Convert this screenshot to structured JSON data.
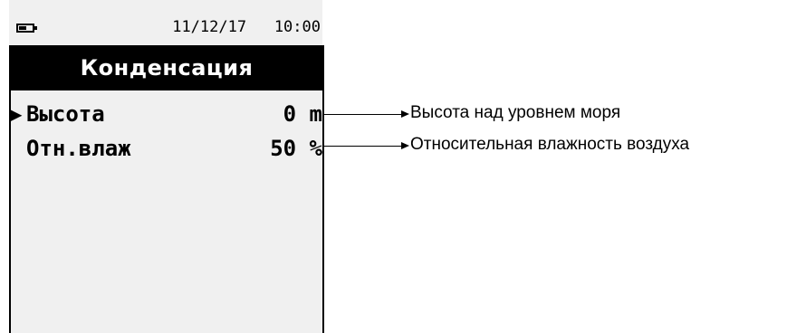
{
  "status_bar": {
    "battery_icon": "battery-icon",
    "date": "11/12/17",
    "time": "10:00"
  },
  "screen": {
    "title": "Конденсация",
    "rows": [
      {
        "selected": true,
        "cursor": "▶",
        "label": "Высота",
        "value": "0 m"
      },
      {
        "selected": false,
        "cursor": "",
        "label": "Отн.влаж",
        "value": "50 %"
      }
    ]
  },
  "callouts": [
    {
      "text": "Высота над уровнем моря"
    },
    {
      "text": "Относительная влажность воздуха"
    }
  ]
}
